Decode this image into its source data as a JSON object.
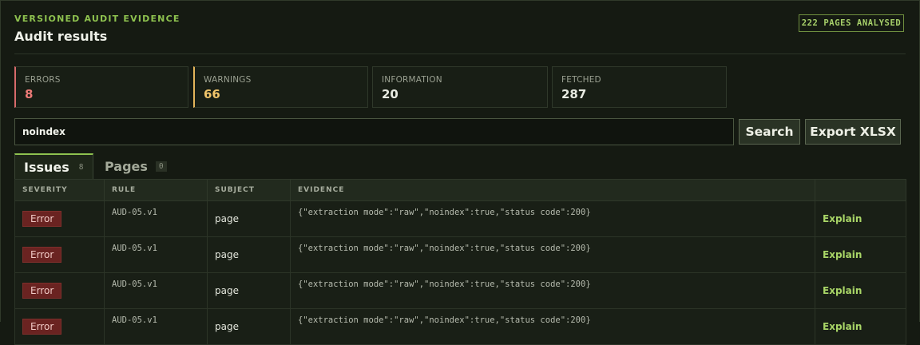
{
  "header": {
    "eyebrow": "VERSIONED AUDIT EVIDENCE",
    "title": "Audit results",
    "pages_badge": "222 PAGES ANALYSED"
  },
  "stats": [
    {
      "label": "ERRORS",
      "value": "8"
    },
    {
      "label": "WARNINGS",
      "value": "66"
    },
    {
      "label": "INFORMATION",
      "value": "20"
    },
    {
      "label": "FETCHED",
      "value": "287"
    }
  ],
  "search": {
    "value": "noindex",
    "search_label": "Search",
    "export_label": "Export XLSX"
  },
  "tabs": [
    {
      "label": "Issues",
      "count": "8"
    },
    {
      "label": "Pages",
      "count": "0"
    }
  ],
  "table": {
    "columns": [
      "SEVERITY",
      "RULE",
      "SUBJECT",
      "EVIDENCE",
      ""
    ],
    "rows": [
      {
        "severity": "Error",
        "rule": "AUD-05.v1",
        "subject": "page",
        "evidence": "{\"extraction mode\":\"raw\",\"noindex\":true,\"status code\":200}",
        "action": "Explain"
      },
      {
        "severity": "Error",
        "rule": "AUD-05.v1",
        "subject": "page",
        "evidence": "{\"extraction mode\":\"raw\",\"noindex\":true,\"status code\":200}",
        "action": "Explain"
      },
      {
        "severity": "Error",
        "rule": "AUD-05.v1",
        "subject": "page",
        "evidence": "{\"extraction mode\":\"raw\",\"noindex\":true,\"status code\":200}",
        "action": "Explain"
      },
      {
        "severity": "Error",
        "rule": "AUD-05.v1",
        "subject": "page",
        "evidence": "{\"extraction mode\":\"raw\",\"noindex\":true,\"status code\":200}",
        "action": "Explain"
      }
    ]
  },
  "colors": {
    "accent": "#8ec24f",
    "error": "#ee7b78",
    "warning": "#f0c46a",
    "background": "#151a12"
  }
}
